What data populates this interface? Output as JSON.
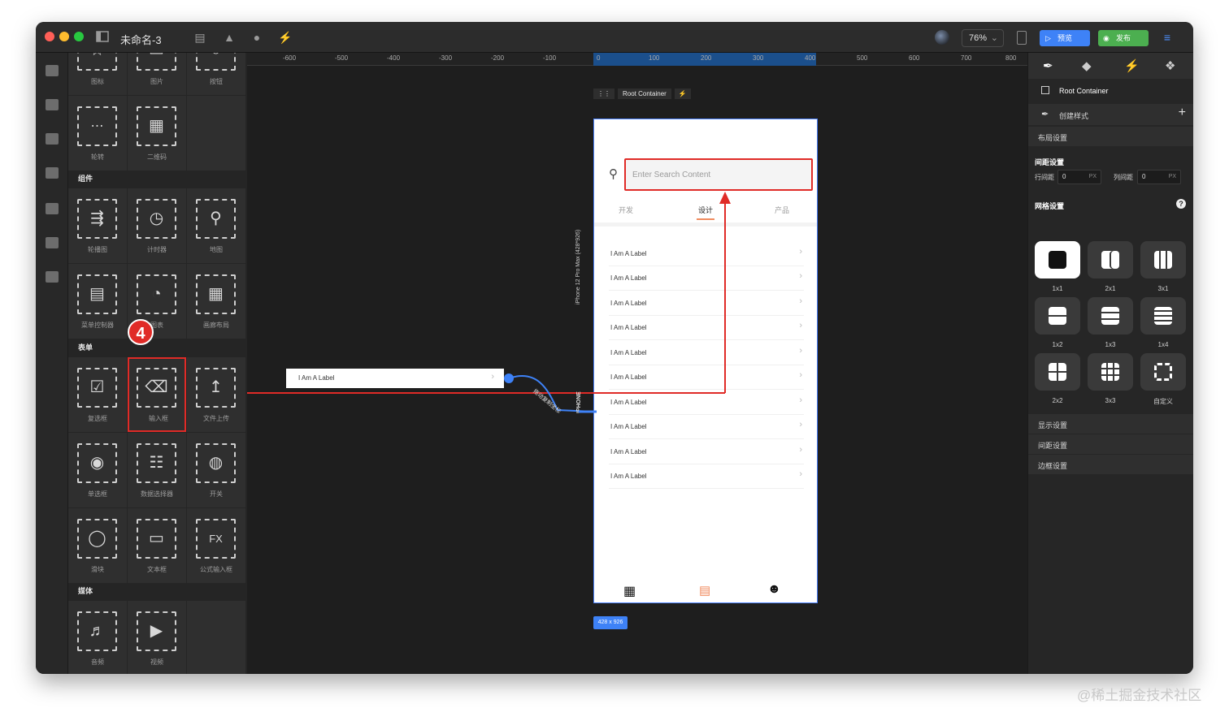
{
  "app": {
    "doc_title": "未命名-3",
    "zoom": "76%",
    "preview_label": "预览",
    "publish_label": "发布"
  },
  "components": {
    "row0": [
      "图标",
      "图片",
      "按钮"
    ],
    "row1": [
      "轮转",
      "二维码"
    ],
    "section_components": "组件",
    "row2": [
      "轮播图",
      "计时器",
      "地图"
    ],
    "row3": [
      "菜单控制器",
      "图表",
      "画廊布局"
    ],
    "section_form": "表单",
    "row4": [
      "复选框",
      "输入框",
      "文件上传"
    ],
    "row5": [
      "单选框",
      "数据选择器",
      "开关"
    ],
    "row6": [
      "滑块",
      "文本框",
      "公式输入框"
    ],
    "section_media": "媒体",
    "row7": [
      "音频",
      "视频"
    ],
    "step_badge": "4"
  },
  "ruler": [
    "-600",
    "-500",
    "-400",
    "-300",
    "-200",
    "-100",
    "0",
    "100",
    "200",
    "300",
    "400",
    "500",
    "600",
    "700",
    "800"
  ],
  "canvas": {
    "root_container": "Root Container",
    "search_placeholder": "Enter Search Content",
    "tabs": [
      "开发",
      "设计",
      "产品"
    ],
    "rows": [
      "I Am A Label",
      "I Am A Label",
      "I Am A Label",
      "I Am A Label",
      "I Am A Label",
      "I Am A Label",
      "I Am A Label",
      "I Am A Label",
      "I Am A Label",
      "I Am A Label"
    ],
    "floating_row": "I Am A Label",
    "device_label": "iPhone 12 Pro Max (428*926)",
    "device_short": "IPHONE",
    "connector_label": "拖动复制坐标",
    "dimensions": "428 x 926"
  },
  "right_panel": {
    "root_container": "Root Container",
    "create_style": "创建样式",
    "layout_settings": "布局设置",
    "spacing_title": "间距设置",
    "row_gap_label": "行间距",
    "row_gap_value": "0",
    "col_gap_label": "列间距",
    "col_gap_value": "0",
    "unit": "PX",
    "grid_title": "网格设置",
    "grid_options": [
      "1x1",
      "2x1",
      "3x1",
      "1x2",
      "1x3",
      "1x4",
      "2x2",
      "3x3",
      "自定义"
    ],
    "display_settings": "显示设置",
    "spacing_settings": "间距设置",
    "border_settings": "边框设置"
  },
  "watermark": "@稀土掘金技术社区",
  "colors": {
    "accent_blue": "#3e82f7",
    "publish_green": "#4caf50",
    "highlight_red": "#e02b27"
  }
}
